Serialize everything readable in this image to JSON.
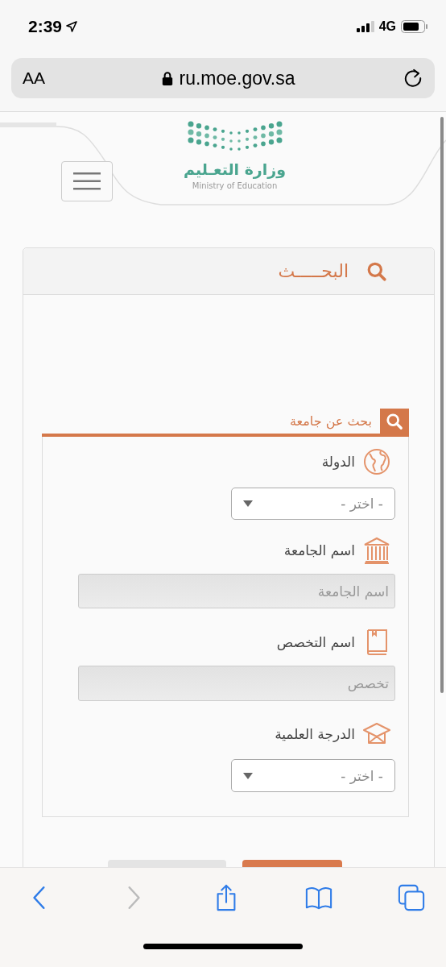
{
  "status_bar": {
    "time": "2:39",
    "network": "4G"
  },
  "address_bar": {
    "text_size": "AA",
    "url": "ru.moe.gov.sa"
  },
  "header": {
    "logo_arabic": "وزارة التعـليم",
    "logo_english": "Ministry of Education"
  },
  "panel": {
    "title": "البحـــــث",
    "section": {
      "title": "بحث عن جامعة",
      "fields": [
        {
          "kind": "select",
          "label": "الدولة",
          "placeholder": "- اختر -"
        },
        {
          "kind": "text",
          "label": "اسم الجامعة",
          "placeholder": "اسم الجامعة"
        },
        {
          "kind": "text",
          "label": "اسم التخصص",
          "placeholder": "تخصص"
        },
        {
          "kind": "select",
          "label": "الدرجة العلمية",
          "placeholder": "- اختر -"
        }
      ]
    }
  }
}
